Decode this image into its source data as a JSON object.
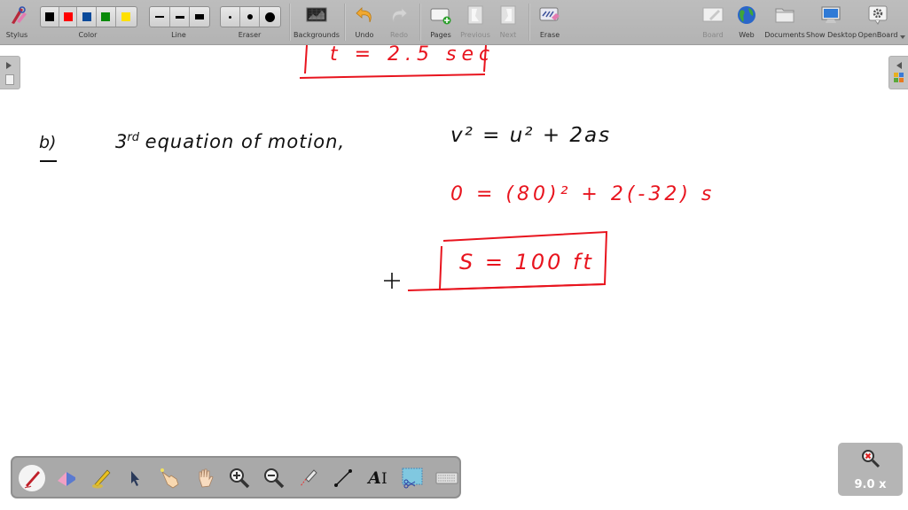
{
  "toolbar": {
    "stylus": "Stylus",
    "color": "Color",
    "line": "Line",
    "eraser": "Eraser",
    "backgrounds": "Backgrounds",
    "undo": "Undo",
    "redo": "Redo",
    "pages": "Pages",
    "previous": "Previous",
    "next": "Next",
    "erase": "Erase",
    "board": "Board",
    "web": "Web",
    "documents": "Documents",
    "show_desktop": "Show Desktop",
    "openboard": "OpenBoard",
    "colors": [
      "#000000",
      "#ff0000",
      "#0a4a9a",
      "#0a8a0a",
      "#ffe000"
    ]
  },
  "canvas": {
    "top_answer": "t = 2.5 sec",
    "part_label": "b)",
    "heading": "3rd equation of motion,",
    "heading_num": "3",
    "heading_sup": "rd",
    "heading_rest": "equation of motion,",
    "equation": "v² = u² + 2as",
    "substitution": "0 = (80)² + 2(-32) s",
    "result": "S = 100 ft",
    "ink_color": "#e8141e"
  },
  "zoom": {
    "level": "9.0 x"
  },
  "bottom_tools": [
    "pen",
    "eraser",
    "highlighter",
    "selector",
    "interactive-pointer",
    "hand",
    "zoom-in",
    "zoom-out",
    "laser-pointer",
    "line",
    "text",
    "capture",
    "virtual-keyboard"
  ]
}
